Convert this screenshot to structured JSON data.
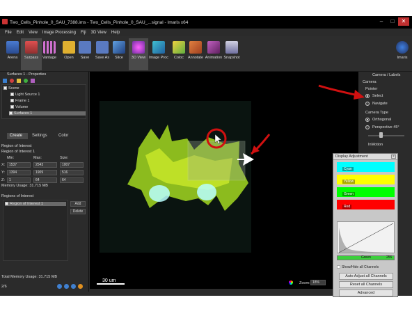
{
  "window": {
    "title": "Two_Cells_Pinhole_0_SAU_7388.ims - Two_Cells_Pinhole_0_SAU_...signal - Imaris x64"
  },
  "menu": [
    "File",
    "Edit",
    "View",
    "Image Processing",
    "Fiji",
    "3D View",
    "Help"
  ],
  "toolbar": [
    "Arena",
    "Surpass",
    "Vantage",
    "Open",
    "Save",
    "Save As",
    "Slice",
    "3D View",
    "Image Proc",
    "Coloc",
    "Annotate",
    "Animation",
    "Snapshot"
  ],
  "toolbar_right": "Imaris",
  "left": {
    "header": "Surfaces 1 - Properties",
    "tree": [
      "Scene",
      "Light Source 1",
      "Frame 1",
      "Volume",
      "Surfaces 1"
    ],
    "tabs": [
      "Create",
      "Settings",
      "Color"
    ],
    "roi_title": "Region of Interest",
    "roi_sub": "Region of Interest 1",
    "col_headers": [
      "Min:",
      "Max:",
      "Size:"
    ],
    "rows": [
      {
        "axis": "X:",
        "min": "1537",
        "max": "2543",
        "size": "1007"
      },
      {
        "axis": "Y:",
        "min": "1394",
        "max": "1909",
        "size": "516"
      },
      {
        "axis": "Z:",
        "min": "1",
        "max": "64",
        "size": "64"
      }
    ],
    "memory": "Memory Usage: 31.715 MB",
    "regions_label": "Regions of Interest",
    "region_item": "Region of Interest 1",
    "add": "Add",
    "delete": "Delete",
    "total_memory": "Total Memory Usage: 31.715 MB",
    "page": "2/6"
  },
  "right": {
    "header": "Camera / Labels",
    "camera": "Camera",
    "pointer": "Pointer",
    "select": "Select",
    "navigate": "Navigate",
    "camera_type": "Camera Type",
    "orthogonal": "Orthogonal",
    "perspective": "Perspective 45°",
    "inmotion": "InMotion"
  },
  "viewer": {
    "scalebar": "30 um"
  },
  "display": {
    "title": "Display Adjustment",
    "channels": [
      {
        "name": "Cyan",
        "color": "#00ffff"
      },
      {
        "name": "Yellow",
        "color": "#ffff00"
      },
      {
        "name": "Green",
        "color": "#00ff00"
      },
      {
        "name": "Red",
        "color": "#ff0000"
      }
    ],
    "hist_channel": "Green",
    "hist_max": "255",
    "show_hide": "Show/Hide all Channels",
    "auto": "Auto Adjust all Channels",
    "reset": "Reset all Channels",
    "advanced": "Advanced"
  },
  "status": {
    "zoom_label": "Zoom:",
    "zoom": "18%"
  }
}
